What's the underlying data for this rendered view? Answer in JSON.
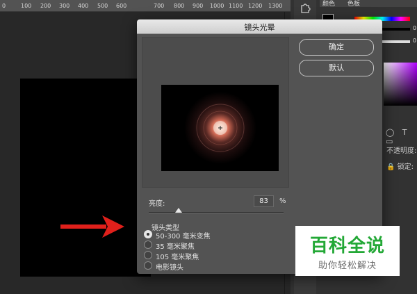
{
  "ruler": {
    "ticks": [
      "0",
      "100",
      "200",
      "300",
      "400",
      "500",
      "600",
      "700",
      "800",
      "900",
      "1000",
      "1100",
      "1200",
      "1300"
    ]
  },
  "panels": {
    "tab_color": "颜色",
    "tab_swatches": "色板",
    "slider_values": [
      "0",
      "0"
    ],
    "layers_icons": "◯ T ▭",
    "opacity_label": "不透明度:",
    "lock_label": "🔒 锁定:"
  },
  "dialog": {
    "title": "镜头光晕",
    "ok_label": "确定",
    "default_label": "默认",
    "brightness_label": "亮度:",
    "brightness_value": "83",
    "brightness_percent": "%",
    "brightness_level": 0.22,
    "lens_type_label": "镜头类型",
    "lens_options": [
      {
        "label": "50-300 毫米变焦",
        "selected": true
      },
      {
        "label": "35 毫米聚焦",
        "selected": false
      },
      {
        "label": "105 毫米聚焦",
        "selected": false
      },
      {
        "label": "电影镜头",
        "selected": false
      }
    ]
  },
  "icons": {
    "puzzle": "puzzle-icon",
    "arrow": "red-arrow-icon"
  },
  "colors": {
    "arrow": "#e0201b",
    "watermark_green": "#23a836"
  },
  "watermark": {
    "title": "百科全说",
    "subtitle": "助你轻松解决"
  }
}
